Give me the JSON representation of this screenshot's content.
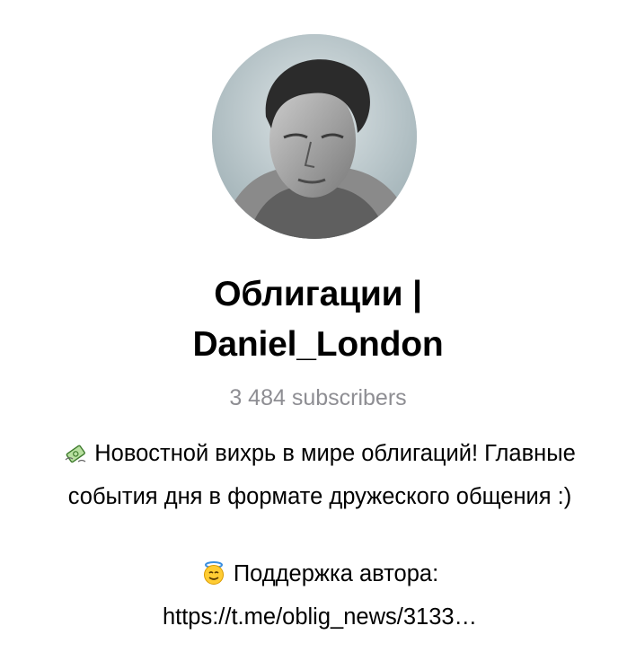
{
  "channel": {
    "title_line1": "Облигации |",
    "title_line2": "Daniel_London",
    "subscribers": "3 484 subscribers"
  },
  "description": {
    "line1": "Новостной вихрь в мире облигаций! Главные",
    "line2": "события дня в формате дружеского общения :)",
    "line3": "Поддержка автора:",
    "line4": "https://t.me/oblig_news/3133…",
    "icons": [
      "money-with-wings-icon",
      "smiling-face-with-halo-icon"
    ]
  }
}
